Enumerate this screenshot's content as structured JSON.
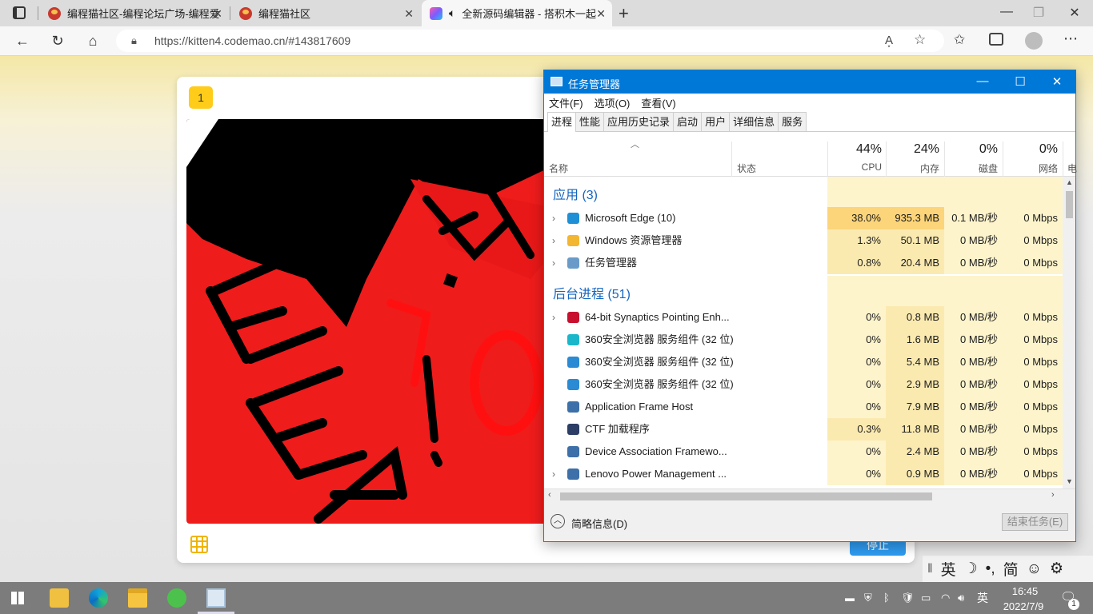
{
  "browser": {
    "tabs": [
      {
        "label": "编程猫社区-编程论坛广场-编程爱"
      },
      {
        "label": "编程猫社区"
      },
      {
        "label": "全新源码编辑器 - 搭积木一起"
      }
    ],
    "new_tab": "+",
    "url": "https://kitten4.codemao.cn/#143817609"
  },
  "editor": {
    "scene_number": "1",
    "stop_label": "停止"
  },
  "ime": {
    "lang": "英",
    "moon": "☽",
    "punct": "•,",
    "simp": "简",
    "emoji": "☺",
    "settings": "⚙"
  },
  "task_manager": {
    "title": "任务管理器",
    "menu": [
      "文件(F)",
      "选项(O)",
      "查看(V)"
    ],
    "tabs": [
      "进程",
      "性能",
      "应用历史记录",
      "启动",
      "用户",
      "详细信息",
      "服务"
    ],
    "columns": {
      "name": "名称",
      "status": "状态",
      "cpu_pct": "44%",
      "cpu": "CPU",
      "mem_pct": "24%",
      "mem": "内存",
      "disk_pct": "0%",
      "disk": "磁盘",
      "net_pct": "0%",
      "net": "网络",
      "power": "电"
    },
    "apps_group": "应用 (3)",
    "bg_group": "后台进程 (51)",
    "apps": [
      {
        "name": "Microsoft Edge (10)",
        "cpu": "38.0%",
        "mem": "935.3 MB",
        "disk": "0.1 MB/秒",
        "net": "0 Mbps",
        "color": "#1f8fd6"
      },
      {
        "name": "Windows 资源管理器",
        "cpu": "1.3%",
        "mem": "50.1 MB",
        "disk": "0 MB/秒",
        "net": "0 Mbps",
        "color": "#f2b632"
      },
      {
        "name": "任务管理器",
        "cpu": "0.8%",
        "mem": "20.4 MB",
        "disk": "0 MB/秒",
        "net": "0 Mbps",
        "color": "#6a9bc8"
      }
    ],
    "background": [
      {
        "name": "64-bit Synaptics Pointing Enh...",
        "cpu": "0%",
        "mem": "0.8 MB",
        "disk": "0 MB/秒",
        "net": "0 Mbps",
        "color": "#c8102e",
        "expand": true
      },
      {
        "name": "360安全浏览器 服务组件 (32 位)",
        "cpu": "0%",
        "mem": "1.6 MB",
        "disk": "0 MB/秒",
        "net": "0 Mbps",
        "color": "#19b7c9",
        "expand": false
      },
      {
        "name": "360安全浏览器 服务组件 (32 位)",
        "cpu": "0%",
        "mem": "5.4 MB",
        "disk": "0 MB/秒",
        "net": "0 Mbps",
        "color": "#2a8ad3",
        "expand": false
      },
      {
        "name": "360安全浏览器 服务组件 (32 位)",
        "cpu": "0%",
        "mem": "2.9 MB",
        "disk": "0 MB/秒",
        "net": "0 Mbps",
        "color": "#2a8ad3",
        "expand": false
      },
      {
        "name": "Application Frame Host",
        "cpu": "0%",
        "mem": "7.9 MB",
        "disk": "0 MB/秒",
        "net": "0 Mbps",
        "color": "#3d6fa8",
        "expand": false
      },
      {
        "name": "CTF 加载程序",
        "cpu": "0.3%",
        "mem": "11.8 MB",
        "disk": "0 MB/秒",
        "net": "0 Mbps",
        "color": "#2c3e66",
        "expand": false
      },
      {
        "name": "Device Association Framewo...",
        "cpu": "0%",
        "mem": "2.4 MB",
        "disk": "0 MB/秒",
        "net": "0 Mbps",
        "color": "#3d6fa8",
        "expand": false
      },
      {
        "name": "Lenovo Power Management ...",
        "cpu": "0%",
        "mem": "0.9 MB",
        "disk": "0 MB/秒",
        "net": "0 Mbps",
        "color": "#3d6fa8",
        "expand": true
      }
    ],
    "footer_less": "简略信息(D)",
    "end_task": "结束任务(E)"
  },
  "taskbar": {
    "time": "16:45",
    "date": "2022/7/9",
    "lang": "英",
    "notifications": "1"
  }
}
